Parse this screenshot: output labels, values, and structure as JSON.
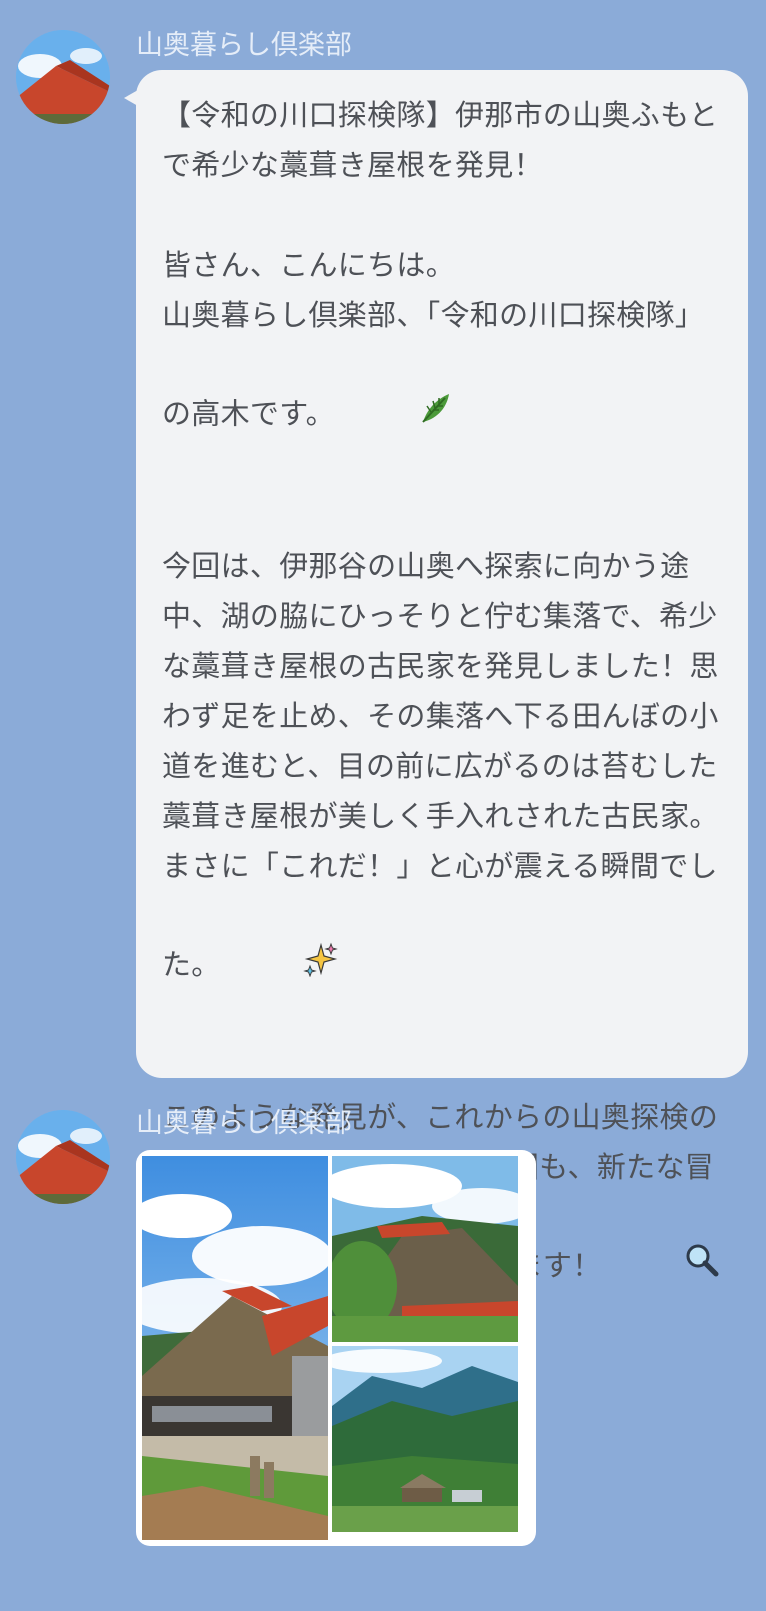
{
  "messages": [
    {
      "sender": "山奥暮らし倶楽部",
      "title": "【令和の川口探検隊】伊那市の山奥ふもとで希少な藁葺き屋根を発見！",
      "greeting": "皆さん、こんにちは。",
      "intro": "山奥暮らし倶楽部、「令和の川口探検隊」の高木です。",
      "intro_emoji": "leaf-icon",
      "body": "今回は、伊那谷の山奥へ探索に向かう途中、湖の脇にひっそりと佇む集落で、希少な藁葺き屋根の古民家を発見しました！思わず足を止め、その集落へ下る田んぼの小道を進むと、目の前に広がるのは苔むした藁葺き屋根が美しく手入れされた古民家。まさに「これだ！」と心が震える瞬間でした。",
      "body_emoji": "sparkles-icon",
      "closing": "このような発見が、これからの山奥探検の大きな励みとなります。次回も、新たな冒険で驚きの発見をお届けします！",
      "closing_emoji": "magnifier-icon"
    },
    {
      "sender": "山奥暮らし倶楽部",
      "photos": [
        "thatched-house-front-photo",
        "thatched-roof-close-photo",
        "mountain-village-photo"
      ]
    }
  ],
  "colors": {
    "background": "#8babd8",
    "bubble": "#f2f3f5",
    "text": "#4e5157",
    "roof": "#c8462c"
  }
}
